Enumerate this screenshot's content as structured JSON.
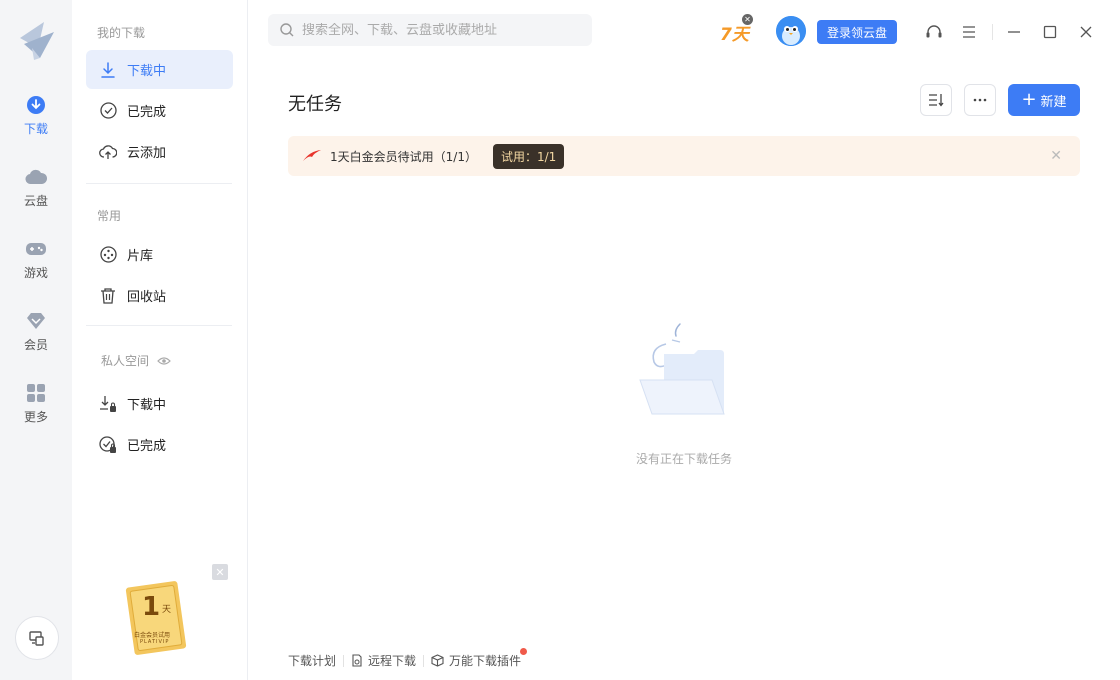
{
  "rail": {
    "items": [
      {
        "label": "下载"
      },
      {
        "label": "云盘"
      },
      {
        "label": "游戏"
      },
      {
        "label": "会员"
      },
      {
        "label": "更多"
      }
    ]
  },
  "sidebar": {
    "section_my": "我的下载",
    "my_items": [
      {
        "label": "下载中"
      },
      {
        "label": "已完成"
      },
      {
        "label": "云添加"
      }
    ],
    "section_common": "常用",
    "common_items": [
      {
        "label": "片库"
      },
      {
        "label": "回收站"
      }
    ],
    "section_private": "私人空间",
    "private_items": [
      {
        "label": "下载中"
      },
      {
        "label": "已完成"
      }
    ],
    "promo": {
      "number": "1",
      "unit": "天",
      "text": "白金会员试用",
      "sub": "PLATIVIP"
    }
  },
  "topbar": {
    "search_placeholder": "搜索全网、下载、云盘或收藏地址",
    "days_badge": "7天",
    "login_label": "登录领云盘"
  },
  "main": {
    "title": "无任务",
    "new_label": "新建",
    "banner_text": "1天白金会员待试用（1/1）",
    "banner_badge": "试用：1/1",
    "empty_text": "没有正在下载任务"
  },
  "footer": {
    "items": [
      {
        "label": "下载计划"
      },
      {
        "label": "远程下载"
      },
      {
        "label": "万能下载插件"
      }
    ]
  },
  "colors": {
    "accent": "#3d7cf5",
    "banner_bg": "#fdf3ea",
    "badge_bg": "#3a3129",
    "badge_text": "#f3d7a2",
    "orange": "#f59a28"
  }
}
